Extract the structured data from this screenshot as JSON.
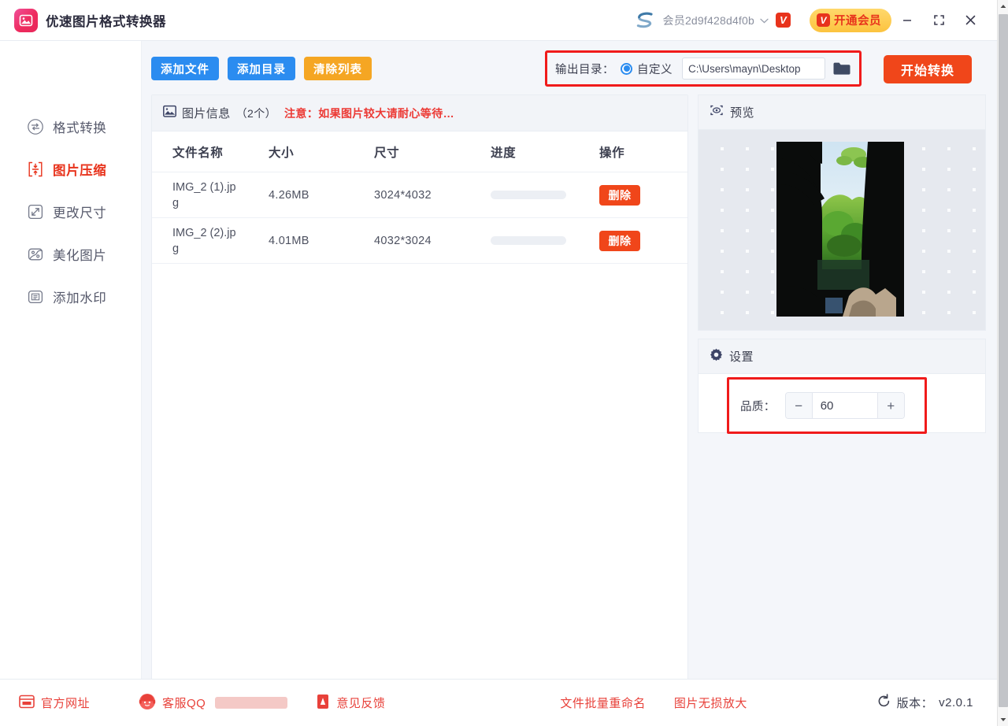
{
  "titlebar": {
    "app_title": "优速图片格式转换器",
    "app_logo_icon": "image-app-icon",
    "member_avatar_icon": "s-logo-avatar",
    "member_name": "会员2d9f428d4f0b",
    "member_dropdown_icon": "chevron-down-icon",
    "vip_badge_icon": "v-badge-icon",
    "vip_badge_text": "V",
    "vip_button_label": "开通会员",
    "minimize_icon": "minimize-icon",
    "maximize_icon": "maximize-icon",
    "close_icon": "close-icon"
  },
  "sidebar": {
    "items": [
      {
        "label": "格式转换",
        "icon": "convert-arrows-icon",
        "active": false
      },
      {
        "label": "图片压缩",
        "icon": "compress-icon",
        "active": true
      },
      {
        "label": "更改尺寸",
        "icon": "resize-icon",
        "active": false
      },
      {
        "label": "美化图片",
        "icon": "beautify-icon",
        "active": false
      },
      {
        "label": "添加水印",
        "icon": "watermark-icon",
        "active": false
      }
    ]
  },
  "toolbar": {
    "add_file_label": "添加文件",
    "add_dir_label": "添加目录",
    "clear_list_label": "清除列表",
    "output_dir_label": "输出目录：",
    "custom_radio_label": "自定义",
    "output_path_value": "C:\\Users\\mayn\\Desktop",
    "output_path_placeholder": "C:\\Users\\mayn\\Desktop",
    "folder_icon": "folder-icon",
    "start_button_label": "开始转换"
  },
  "list_panel": {
    "header_icon": "image-info-icon",
    "header_title": "图片信息",
    "header_count": "（2个）",
    "header_warning": "注意：如果图片较大请耐心等待…",
    "columns": [
      "文件名称",
      "大小",
      "尺寸",
      "进度",
      "操作"
    ],
    "rows": [
      {
        "filename": "IMG_2 (1).jpg",
        "size": "4.26MB",
        "dimensions": "3024*4032",
        "progress": 0,
        "delete_label": "删除"
      },
      {
        "filename": "IMG_2 (2).jpg",
        "size": "4.01MB",
        "dimensions": "4032*3024",
        "progress": 0,
        "delete_label": "删除"
      }
    ]
  },
  "preview_panel": {
    "icon": "eye-preview-icon",
    "title": "预览"
  },
  "settings_panel": {
    "icon": "gear-icon",
    "title": "设置",
    "quality_label": "品质：",
    "quality_value": "60",
    "minus_label": "−",
    "plus_label": "+"
  },
  "footer": {
    "site_label": "官方网址",
    "site_icon": "website-icon",
    "qq_label": "客服QQ",
    "qq_icon": "service-avatar-icon",
    "qq_value_redacted": "",
    "feedback_label": "意见反馈",
    "feedback_icon": "feedback-icon",
    "rename_label": "文件批量重命名",
    "enlarge_label": "图片无损放大",
    "version_icon": "refresh-icon",
    "version_label": "版本：",
    "version_value": "v2.0.1"
  },
  "colors": {
    "accent_red": "#e8331c",
    "orange_action": "#f0461a",
    "blue_button": "#2b8cf0",
    "orange_button": "#f5a623",
    "vip_gold": "#fcc33f",
    "annotation_red": "#f01b1b",
    "panel_bg": "#f4f6fa"
  },
  "scrollbar": {
    "up_arrow_icon": "scroll-up-arrow-icon",
    "down_arrow_icon": "scroll-down-arrow-icon"
  }
}
